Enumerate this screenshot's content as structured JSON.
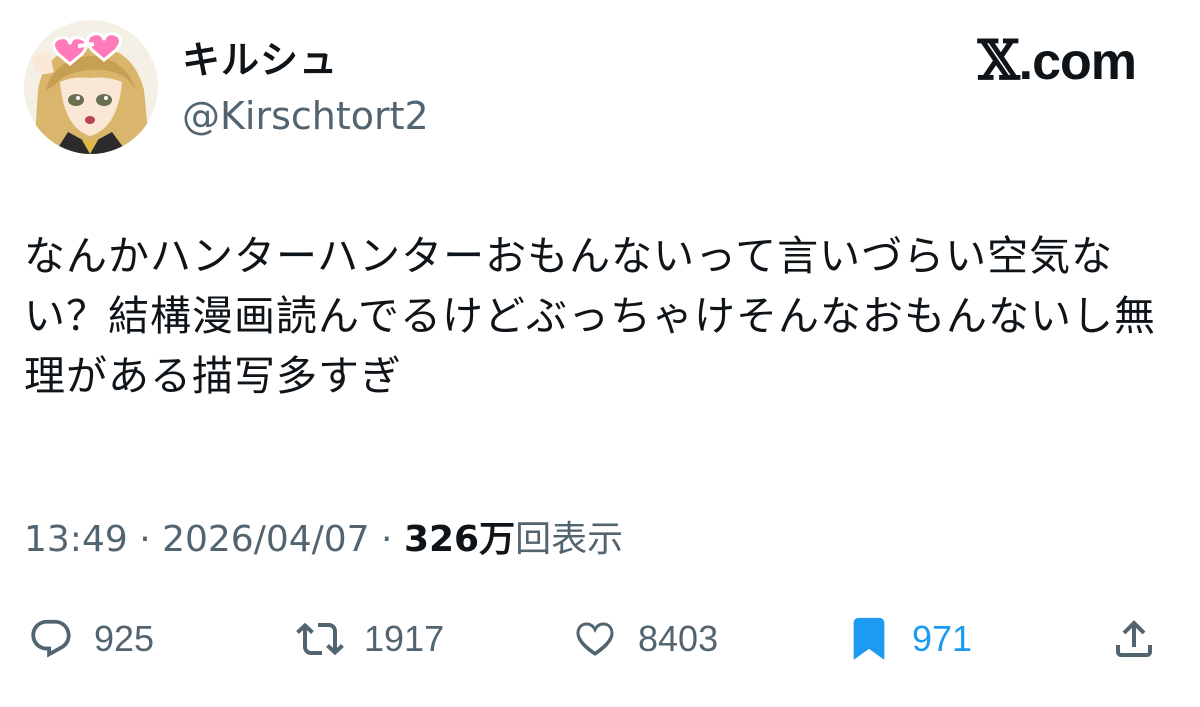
{
  "header": {
    "display_name": "キルシュ",
    "handle": "@Kirschtort2",
    "brand_mark": "𝕏",
    "brand_suffix": ".com"
  },
  "tweet": {
    "text": "なんかハンターハンターおもんないって言いづらい空気ない？結構漫画読んでるけどぶっちゃけそんなおもんないし無理がある描写多すぎ",
    "time": "13:49",
    "separator": " · ",
    "date": "2026/04/07",
    "views_count": "326万",
    "views_label": "回表示"
  },
  "actions": {
    "reply": {
      "icon": "reply-icon",
      "count": "925"
    },
    "retweet": {
      "icon": "retweet-icon",
      "count": "1917"
    },
    "like": {
      "icon": "heart-icon",
      "count": "8403"
    },
    "bookmark": {
      "icon": "bookmark-icon",
      "count": "971",
      "active": true,
      "color": "#1d9bf0"
    },
    "share": {
      "icon": "share-icon"
    }
  },
  "colors": {
    "text_primary": "#0f1419",
    "text_secondary": "#536471",
    "accent": "#1d9bf0"
  }
}
